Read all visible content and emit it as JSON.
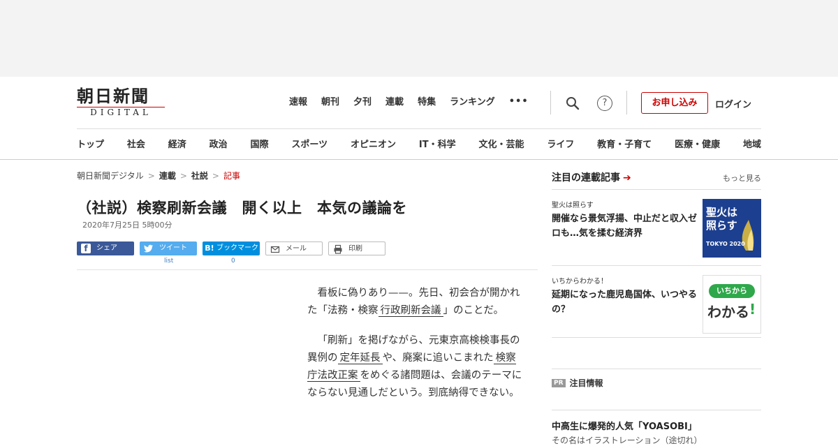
{
  "header": {
    "logo_jp": "朝日新聞",
    "logo_en": "DIGITAL",
    "top_nav": [
      "速報",
      "朝刊",
      "夕刊",
      "連載",
      "特集",
      "ランキング"
    ],
    "more": "•••",
    "help": "?",
    "apply": "お申し込み",
    "login": "ログイン",
    "categories": [
      "トップ",
      "社会",
      "経済",
      "政治",
      "国際",
      "スポーツ",
      "オピニオン",
      "IT・科学",
      "文化・芸能",
      "ライフ",
      "教育・子育て",
      "医療・健康",
      "地域"
    ]
  },
  "breadcrumb": [
    "朝日新聞デジタル",
    "連載",
    "社説",
    "記事"
  ],
  "breadcrumb_sep": ">",
  "article": {
    "title": "（社説）検察刷新会議　開く以上　本気の議論を",
    "date": "2020年7月25日 5時00分",
    "share": {
      "facebook": "シェア",
      "twitter": "ツイート",
      "hatena": "ブックマーク",
      "mail": "メール",
      "print": "印刷",
      "twitter_count": "list",
      "hatena_count": "0"
    },
    "paragraphs": [
      {
        "a": "看板に偽りあり——。先日、初会合が開かれた「法務・検察",
        "k1": "行政刷新会議",
        "b": "」のことだ。"
      },
      {
        "a": "「刷新」を掲げながら、元東京高検検事長の異例の",
        "k1": "定年延長",
        "b": "や、廃案に追いこまれた",
        "k2": "検察庁法改正案",
        "c": "をめぐる諸問題は、会議のテーマにならない見通しだという。到底納得できない。"
      }
    ]
  },
  "sidebar": {
    "title": "注目の連載記事",
    "more": "もっと見る",
    "items": [
      {
        "tag": "聖火は照らす",
        "headline": "開催なら景気浮揚、中止だと収入ゼロも…気を揉む経済界",
        "thumb_line1": "聖火は",
        "thumb_line2": "照らす",
        "thumb_sub": "TOKYO 2020"
      },
      {
        "tag": "いちからわかる！",
        "headline": "延期になった鹿児島国体、いつやるの？",
        "thumb_line1": "いちから",
        "thumb_line2": "わかる",
        "thumb_mark": "!"
      }
    ],
    "pr_badge": "PR",
    "pr_label": "注目情報",
    "pr_headline": "中高生に爆発的人気「YOASOBI」",
    "pr_sub": "その名はイラストレーション（途切れ）"
  },
  "colors": {
    "brand_red": "#cc0000",
    "facebook": "#3b5998",
    "twitter": "#55acee",
    "hatena": "#008fde"
  }
}
